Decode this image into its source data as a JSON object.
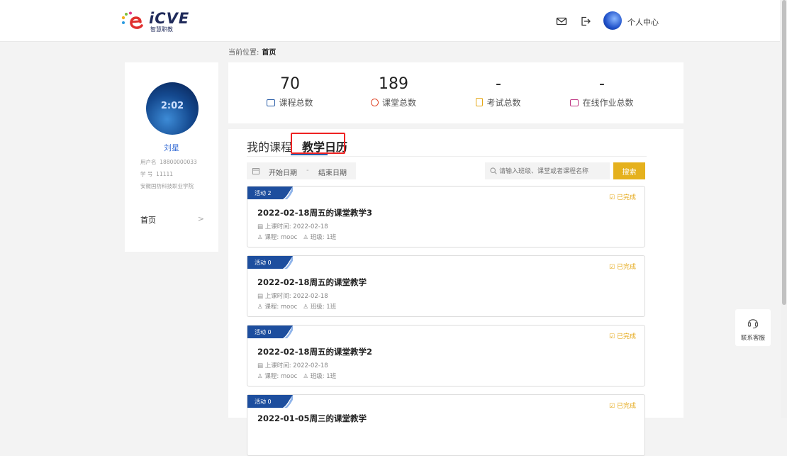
{
  "app": {
    "logo_text": "iCVE",
    "logo_sub": "智慧职教",
    "personal_center": "个人中心"
  },
  "breadcrumb": {
    "prefix": "当前位置:",
    "current": "首页"
  },
  "profile": {
    "avatar_time": "2:02",
    "name": "刘星",
    "username_label": "用户名",
    "username": "18800000033",
    "id_label": "学  号",
    "id": "11111",
    "school": "安徽国防科技职业学院",
    "menu_home": "首页"
  },
  "stats": [
    {
      "value": "70",
      "label": "课程总数",
      "color": "#2b5ea8"
    },
    {
      "value": "189",
      "label": "课堂总数",
      "color": "#e0492c"
    },
    {
      "value": "-",
      "label": "考试总数",
      "color": "#e5a818"
    },
    {
      "value": "-",
      "label": "在线作业总数",
      "color": "#c03b86"
    }
  ],
  "tabs": {
    "my_courses": "我的课程",
    "teaching_calendar": "教学日历"
  },
  "filters": {
    "start_date": "开始日期",
    "separator": "-",
    "end_date": "结束日期",
    "search_placeholder": "请输入班级、课堂或者课程名称",
    "search_button": "搜索"
  },
  "cards": [
    {
      "badge": "活动 2",
      "status": "已完成",
      "title": "2022-02-18周五的课堂教学3",
      "time": "上课时间: 2022-02-18",
      "course": "课程: mooc",
      "class": "班级: 1班"
    },
    {
      "badge": "活动 0",
      "status": "已完成",
      "title": "2022-02-18周五的课堂教学",
      "time": "上课时间: 2022-02-18",
      "course": "课程: mooc",
      "class": "班级: 1班"
    },
    {
      "badge": "活动 0",
      "status": "已完成",
      "title": "2022-02-18周五的课堂教学2",
      "time": "上课时间: 2022-02-18",
      "course": "课程: mooc",
      "class": "班级: 1班"
    },
    {
      "badge": "活动 0",
      "status": "已完成",
      "title": "2022-01-05周三的课堂教学",
      "time": "",
      "course": "",
      "class": ""
    }
  ],
  "service": {
    "label": "联系客服"
  },
  "colors": {
    "accent": "#2b5ea8",
    "button": "#e5b11d",
    "status": "#e5a818",
    "highlight": "#ee2222"
  }
}
